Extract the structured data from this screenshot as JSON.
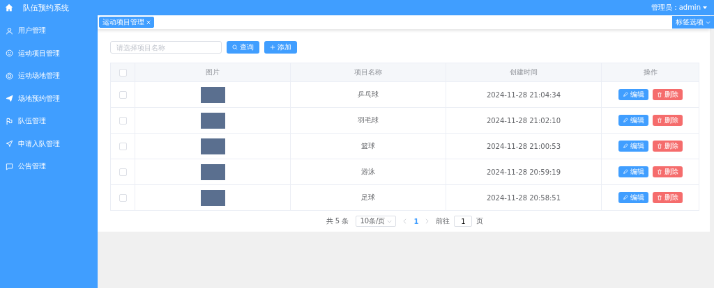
{
  "header": {
    "title": "队伍预约系统",
    "user_label": "管理员：admin"
  },
  "sidebar": {
    "items": [
      {
        "label": "用户管理",
        "selected": false
      },
      {
        "label": "运动项目管理",
        "selected": false
      },
      {
        "label": "运动场地管理",
        "selected": false
      },
      {
        "label": "场地预约管理",
        "selected": false
      },
      {
        "label": "队伍管理",
        "selected": false
      },
      {
        "label": "申请入队管理",
        "selected": false
      },
      {
        "label": "公告管理",
        "selected": false
      }
    ]
  },
  "tabs": [
    {
      "label": "运动项目管理",
      "selected": true
    }
  ],
  "tab_options": "标签选项",
  "search": {
    "placeholder": "请选择项目名称"
  },
  "toolbar": [
    "查询",
    "添加"
  ],
  "table": {
    "columns": [
      "图片",
      "项目名称",
      "创建时间",
      "操作"
    ],
    "header_checked": false,
    "rows": [
      {
        "checked": false,
        "name": "乒乓球",
        "created": "2024-11-28 21:04:34",
        "edit": "编辑",
        "delete": "删除"
      },
      {
        "checked": false,
        "name": "羽毛球",
        "created": "2024-11-28 21:02:10",
        "edit": "编辑",
        "delete": "删除"
      },
      {
        "checked": false,
        "name": "篮球",
        "created": "2024-11-28 21:00:53",
        "edit": "编辑",
        "delete": "删除"
      },
      {
        "checked": false,
        "name": "游泳",
        "created": "2024-11-28 20:59:19",
        "edit": "编辑",
        "delete": "删除"
      },
      {
        "checked": false,
        "name": "足球",
        "created": "2024-11-28 20:58:51",
        "edit": "编辑",
        "delete": "删除"
      }
    ]
  },
  "pagination": {
    "total": "共 5 条",
    "page_size": "10条/页",
    "pages": [
      {
        "label": "1",
        "selected": true
      }
    ],
    "goto_label": "前往",
    "goto_value": "1",
    "page_unit": "页"
  }
}
